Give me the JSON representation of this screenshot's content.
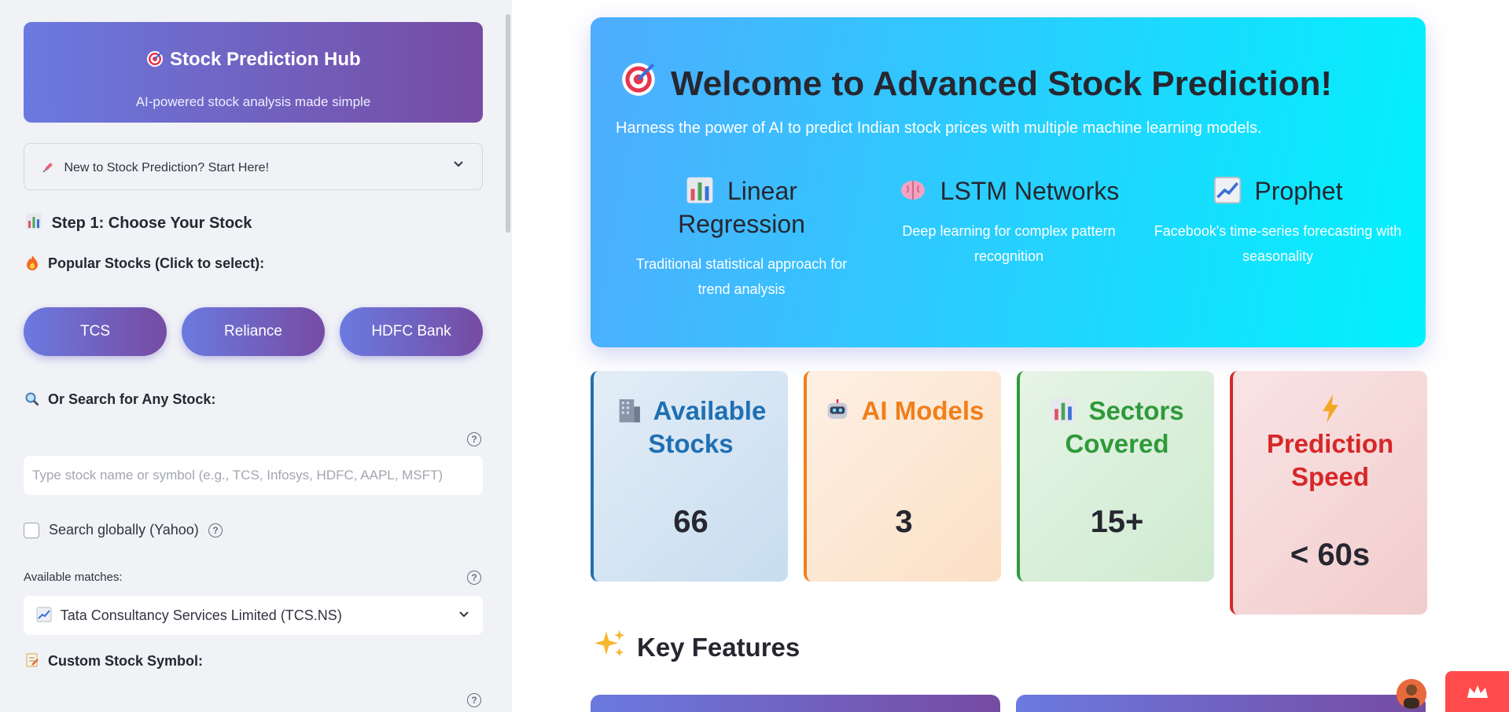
{
  "sidebar": {
    "hub": {
      "title": "Stock Prediction Hub",
      "subtitle": "AI-powered stock analysis made simple",
      "icon": "target-icon"
    },
    "expander": {
      "label": "New to Stock Prediction? Start Here!",
      "icon": "syringe-icon"
    },
    "step1": {
      "label": "Step 1: Choose Your Stock",
      "icon": "bar-chart-icon"
    },
    "popular": {
      "label": "Popular Stocks (Click to select):",
      "icon": "fire-icon"
    },
    "popular_buttons": [
      "TCS",
      "Reliance",
      "HDFC Bank"
    ],
    "search_heading": {
      "label": "Or Search for Any Stock:",
      "icon": "magnifier-icon"
    },
    "search": {
      "placeholder": "Type stock name or symbol (e.g., TCS, Infosys, HDFC, AAPL, MSFT)",
      "value": ""
    },
    "global_search": {
      "label": "Search globally (Yahoo)",
      "checked": false
    },
    "matches": {
      "label": "Available matches:",
      "selected": "Tata Consultancy Services Limited (TCS.NS)",
      "icon": "chart-up-icon"
    },
    "custom": {
      "label": "Custom Stock Symbol:",
      "icon": "memo-icon"
    }
  },
  "hero": {
    "title": "Welcome to Advanced Stock Prediction!",
    "subtitle": "Harness the power of AI to predict Indian stock prices with multiple machine learning models.",
    "models": [
      {
        "title": "Linear Regression",
        "desc": "Traditional statistical approach for trend analysis",
        "icon": "bar-chart-icon"
      },
      {
        "title": "LSTM Networks",
        "desc": "Deep learning for complex pattern recognition",
        "icon": "brain-icon"
      },
      {
        "title": "Prophet",
        "desc": "Facebook's time-series forecasting with seasonality",
        "icon": "chart-up-icon"
      }
    ]
  },
  "stats": [
    {
      "title": "Available Stocks",
      "value": "66",
      "color": "#1f6fb2",
      "icon": "building-icon"
    },
    {
      "title": "AI Models",
      "value": "3",
      "color": "#f07f1a",
      "icon": "robot-icon"
    },
    {
      "title": "Sectors Covered",
      "value": "15+",
      "color": "#2e9a3a",
      "icon": "bar-chart-icon"
    },
    {
      "title": "Prediction Speed",
      "value": "< 60s",
      "color": "#d62728",
      "icon": "lightning-icon"
    }
  ],
  "key_features": {
    "title": "Key Features",
    "icon": "sparkles-icon"
  },
  "colors": {
    "accent_start": "#667eea",
    "accent_end": "#764ba2",
    "hero_start": "#4facfe",
    "hero_end": "#00f2fe"
  }
}
